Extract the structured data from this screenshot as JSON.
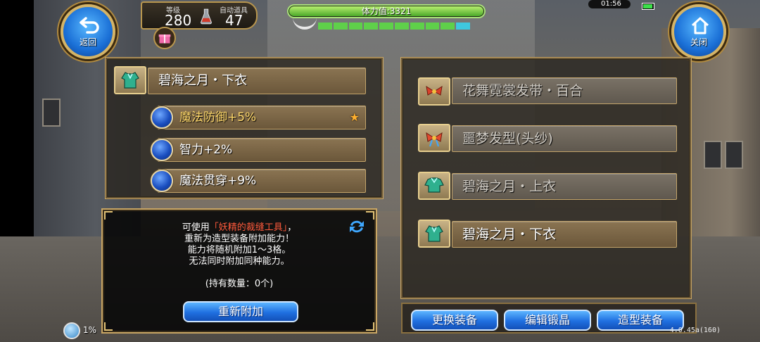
{
  "hud": {
    "back_label": "返回",
    "close_label": "关闭",
    "level_caption": "等级",
    "level_value": "280",
    "auto_potion_caption": "自动道具",
    "auto_potion_value": "47",
    "stamina_text": "体力值:3321",
    "stamina_fraction": 1.0,
    "clock": "01:56",
    "battery_fraction": 0.8
  },
  "left_panel": {
    "item_name": "碧海之月・下衣",
    "abilities": [
      {
        "label": "魔法防御+5%",
        "highlight": true
      },
      {
        "label": "智力+2%",
        "highlight": false
      },
      {
        "label": "魔法贯穿+9%",
        "highlight": false
      }
    ]
  },
  "info_box": {
    "line1_prefix": "可使用",
    "line1_item": "「妖精的裁缝工具」",
    "line1_suffix": "，",
    "line2": "重新为造型装备附加能力！",
    "line3": "能力将随机附加1～3格。",
    "line4": "无法同时附加同种能力。",
    "owned": "(持有数量：0个)",
    "reroll_button": "重新附加"
  },
  "right_panel": {
    "items": [
      {
        "label": "花舞霓裳发带・百合",
        "icon": "ribbon-icon",
        "dim": true
      },
      {
        "label": "噩梦发型(头纱)",
        "icon": "ribbon-icon",
        "dim": true
      },
      {
        "label": "碧海之月・上衣",
        "icon": "armor-icon",
        "dim": true
      },
      {
        "label": "碧海之月・下衣",
        "icon": "armor-icon",
        "dim": false
      }
    ]
  },
  "bottom_buttons": {
    "change_equip": "更换装备",
    "edit_crystal": "编辑锻晶",
    "style_equip": "造型装备"
  },
  "footer": {
    "exp_percent": "1%",
    "version": "4.0.45a(160)"
  },
  "colors": {
    "accent_gold": "#e0c075",
    "highlight_text": "#ffd86b",
    "item_name_red": "#ff5a3c",
    "button_blue": "#1f6fe0"
  }
}
